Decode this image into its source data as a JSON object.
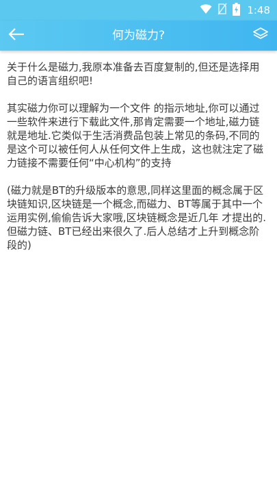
{
  "status_bar": {
    "time": "1:48",
    "icons": [
      "wifi-icon",
      "no-sim-icon",
      "battery-charging-icon"
    ],
    "background_color": "#5bc8f0"
  },
  "app_bar": {
    "title": "何为磁力?",
    "back_icon": "arrow-left-icon",
    "right_icon": "layers-icon",
    "gradient_colors": [
      "#5bc9f1",
      "#40b6f0"
    ]
  },
  "article": {
    "paragraphs": [
      "关于什么是磁力,我原本准备去百度复制的,但还是选择用自己的语言组织吧!",
      "其实磁力你可以理解为一个文件 的指示地址,你可以通过一些软件来进行下载此文件,那肯定需要一个地址,磁力链就是地址.它类似于生活消费品包装上常见的条码,不同的是这个可以被任何人从任何文件上生成，这也就注定了磁力链接不需要任何“中心机构”的支持",
      "(磁力就是BT的升级版本的意思,同样这里面的概念属于区块链知识,区块链是一个概念,而磁力、BT等属于其中一个运用实例,偷偷告诉大家哦,区块链概念是近几年 才提出的.但磁力链、BT已经出来很久了.后人总结才上升到概念阶段的)"
    ]
  }
}
